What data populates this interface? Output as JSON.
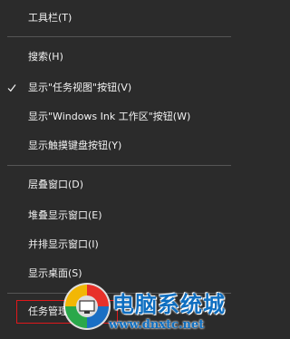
{
  "menu": {
    "toolbars": "工具栏(T)",
    "search": "搜索(H)",
    "show_task_view": "显示\"任务视图\"按钮(V)",
    "show_windows_ink": "显示\"Windows Ink 工作区\"按钮(W)",
    "show_touch_keyboard": "显示触摸键盘按钮(Y)",
    "cascade": "层叠窗口(D)",
    "stacked": "堆叠显示窗口(E)",
    "side_by_side": "并排显示窗口(I)",
    "show_desktop": "显示桌面(S)",
    "task_manager": "任务管理"
  },
  "watermark": {
    "title": "电脑系统城",
    "url": "www.dnxtc.net"
  },
  "colors": {
    "menu_bg": "#2b2b2b",
    "separator": "#555555",
    "highlight": "#e0171b",
    "watermark_blue": "#0e6ec0"
  },
  "icons": {
    "check": "check-icon",
    "logo": "watermark-logo-icon"
  }
}
